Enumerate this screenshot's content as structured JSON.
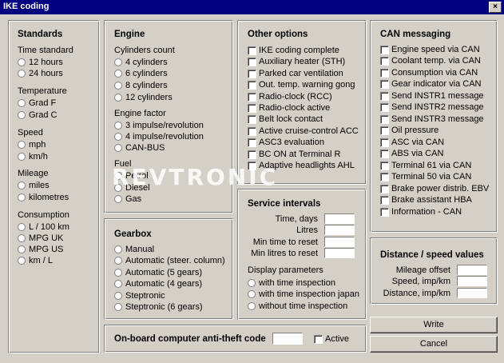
{
  "window": {
    "title": "IKE coding",
    "close_label": "×"
  },
  "standards": {
    "title": "Standards",
    "time_label": "Time standard",
    "time_options": [
      "12 hours",
      "24 hours"
    ],
    "temp_label": "Temperature",
    "temp_options": [
      "Grad F",
      "Grad C"
    ],
    "speed_label": "Speed",
    "speed_options": [
      "mph",
      "km/h"
    ],
    "mileage_label": "Mileage",
    "mileage_options": [
      "miles",
      "kilometres"
    ],
    "consumption_label": "Consumption",
    "consumption_options": [
      "L / 100 km",
      "MPG UK",
      "MPG US",
      "km / L"
    ]
  },
  "engine": {
    "title": "Engine",
    "cyl_label": "Cylinders count",
    "cyl_options": [
      "4 cylinders",
      "6 cylinders",
      "8 cylinders",
      "12 cylinders"
    ],
    "factor_label": "Engine factor",
    "factor_options": [
      "3 impulse/revolution",
      "4 impulse/revolution",
      "CAN-BUS"
    ],
    "fuel_label": "Fuel",
    "fuel_options": [
      "Petrol",
      "Diesel",
      "Gas"
    ]
  },
  "gearbox": {
    "title": "Gearbox",
    "options": [
      "Manual",
      "Automatic (steer. column)",
      "Automatic (5 gears)",
      "Automatic (4 gears)",
      "Steptronic",
      "Steptronic (6 gears)"
    ]
  },
  "other": {
    "title": "Other options",
    "options": [
      "IKE coding complete",
      "Auxiliary heater (STH)",
      "Parked car ventilation",
      "Out. temp. warning gong",
      "Radio-clock (RCC)",
      "Radio-clock active",
      "Belt lock contact",
      "Active cruise-control ACC",
      "ASC3 evaluation",
      "BC ON at Terminal R",
      "Adaptive headlights AHL"
    ]
  },
  "can": {
    "title": "CAN messaging",
    "options": [
      "Engine speed via CAN",
      "Coolant temp. via CAN",
      "Consumption via CAN",
      "Gear indicator via CAN",
      "Send INSTR1 message",
      "Send INSTR2 message",
      "Send INSTR3 message",
      "Oil pressure",
      "ASC via CAN",
      "ABS via CAN",
      "Terminal 61 via CAN",
      "Terminal 50 via CAN",
      "Brake power distrib. EBV",
      "Brake assistant HBA",
      "Information - CAN"
    ]
  },
  "service": {
    "title": "Service intervals",
    "fields": [
      "Time, days",
      "Litres",
      "Min time to reset",
      "Min litres to reset"
    ],
    "display_label": "Display parameters",
    "display_options": [
      "with time inspection",
      "with time inspection japan",
      "without time inspection"
    ]
  },
  "distance": {
    "title": "Distance / speed values",
    "fields": [
      "Mileage offset",
      "Speed, imp/km",
      "Distance, imp/km"
    ]
  },
  "antitheft": {
    "title": "On-board computer anti-theft code",
    "active_label": "Active"
  },
  "buttons": {
    "write": "Write",
    "cancel": "Cancel"
  },
  "watermark": "REVTRONIC"
}
